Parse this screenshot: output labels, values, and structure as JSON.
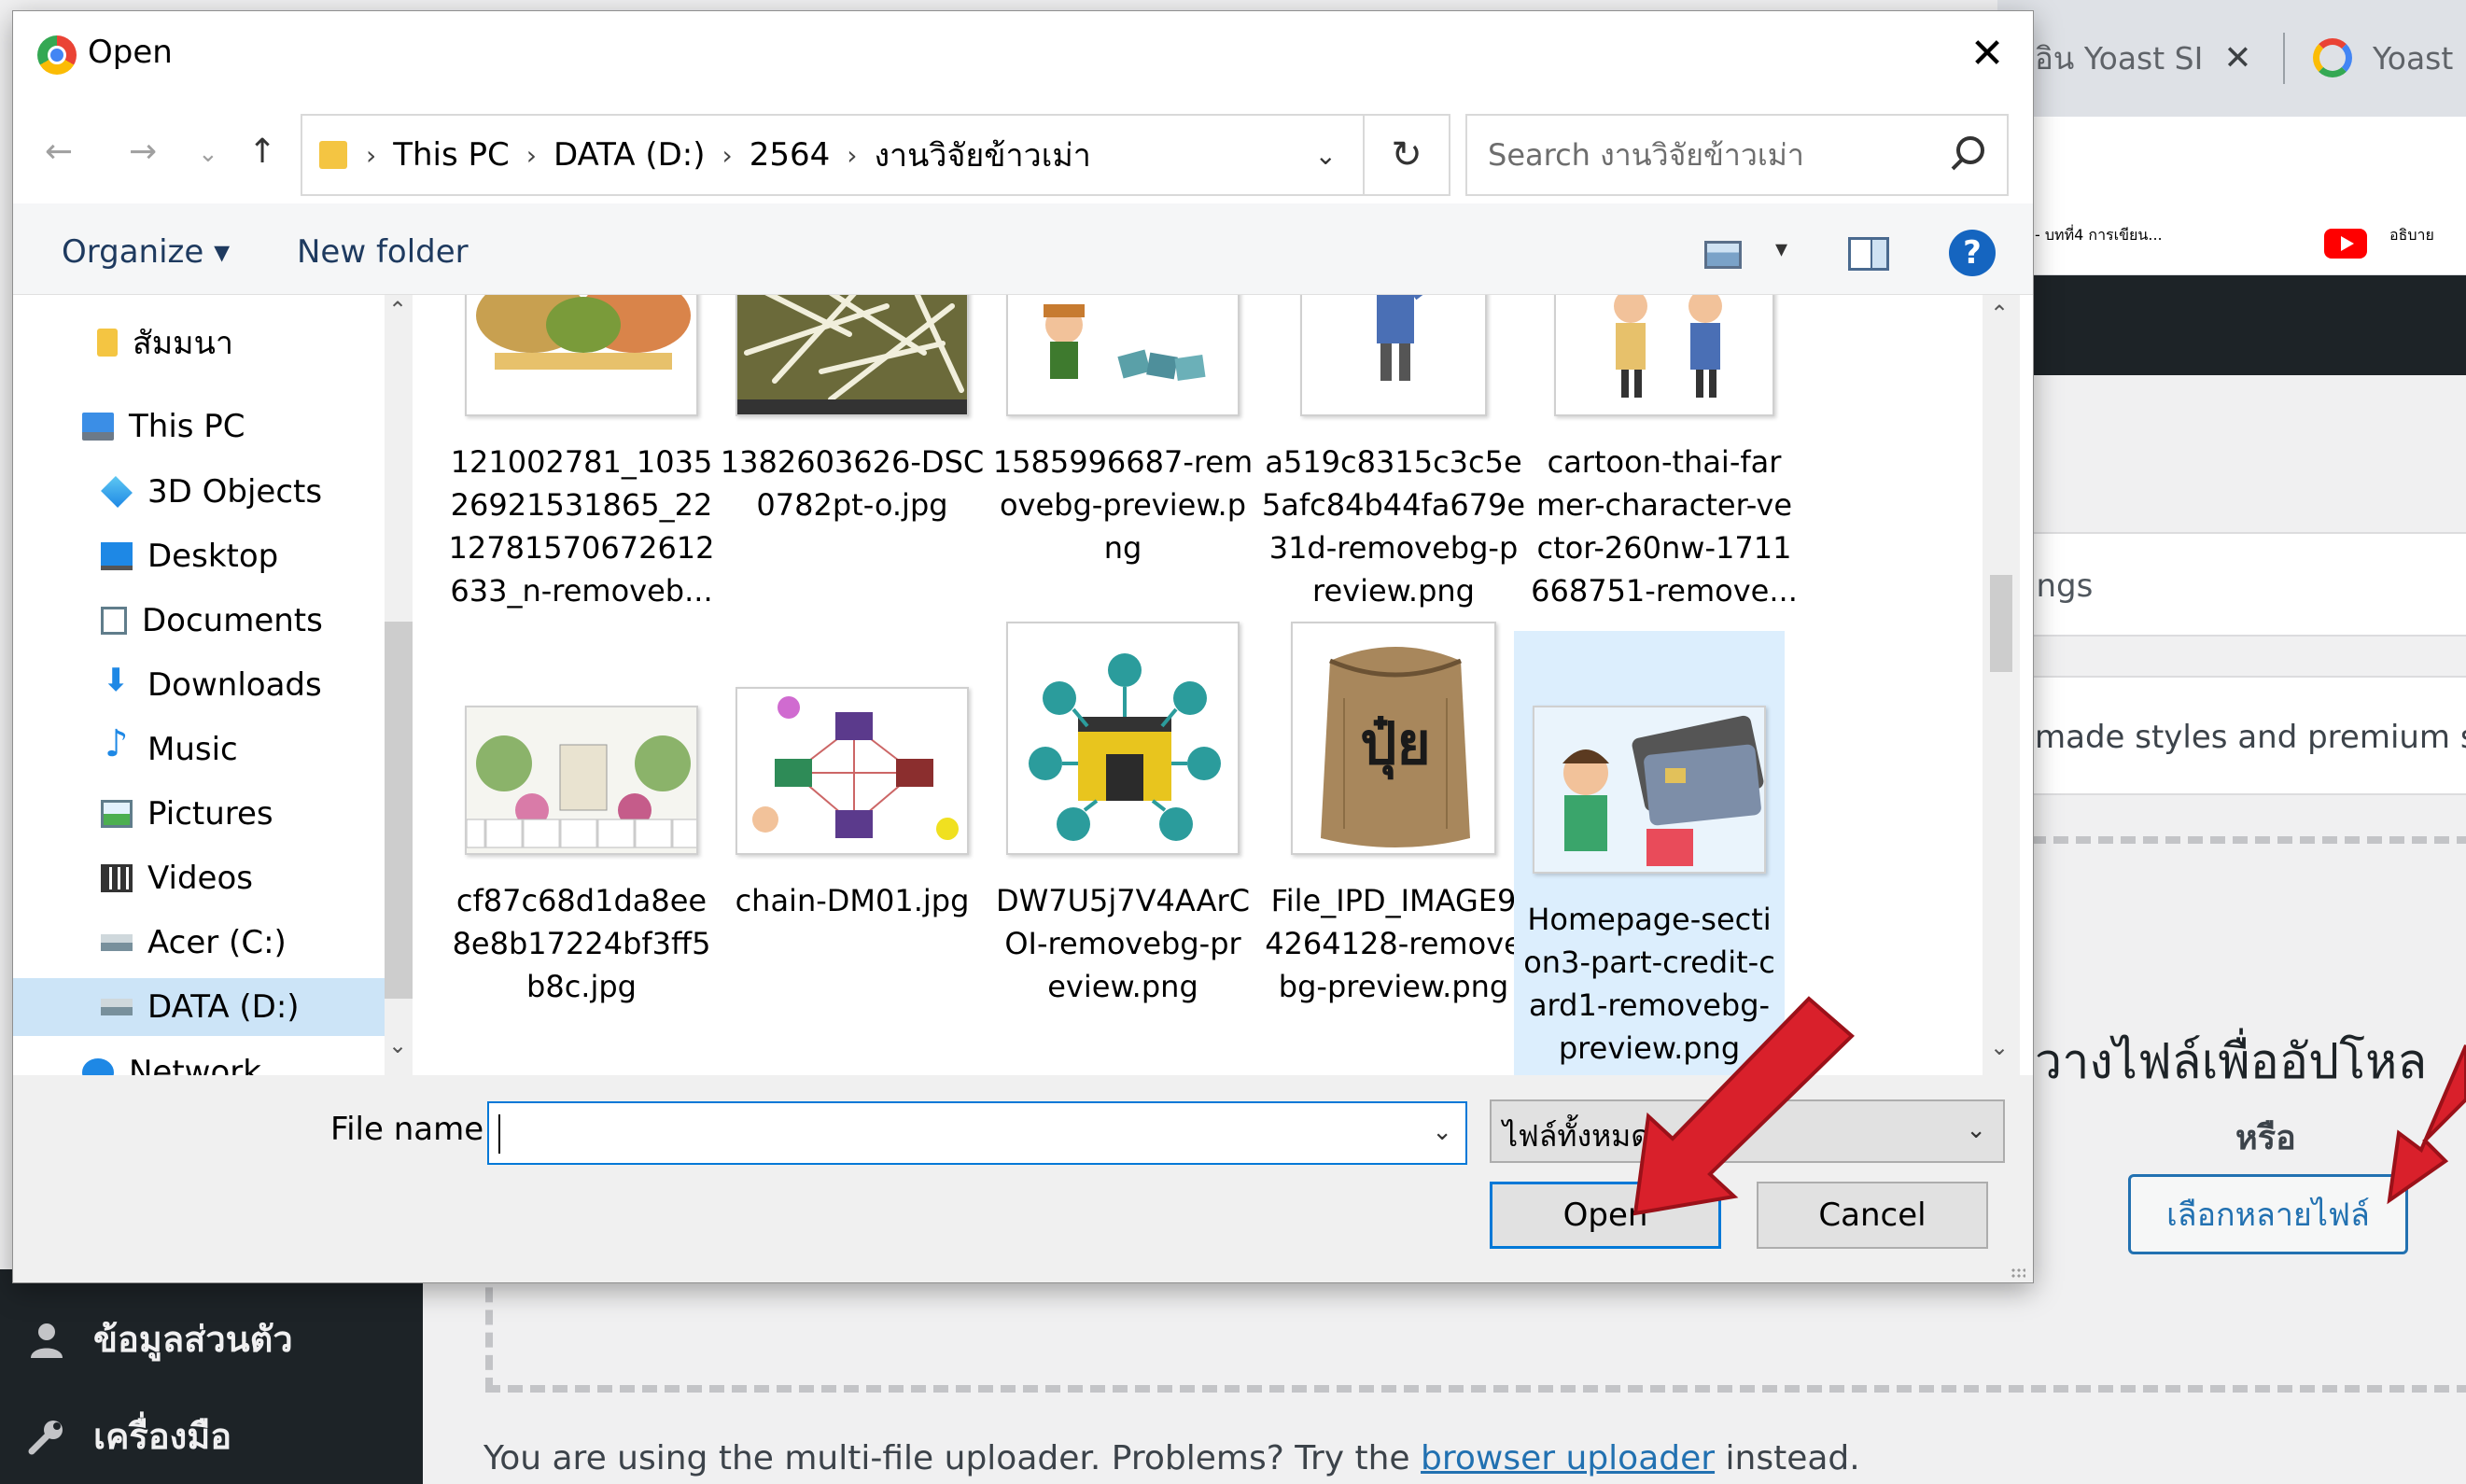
{
  "browser": {
    "tabs": [
      {
        "label": "กอิน Yoast SI",
        "close": "✕"
      },
      {
        "label": "Yoast"
      }
    ],
    "bookmarks": [
      "- บทที่4 การเขียน...",
      "อธิบาย"
    ]
  },
  "wordpress": {
    "settings_text": "ings",
    "premium_text": "made styles and premium su",
    "drop_text": "วางไฟล์เพื่ออัปโหล",
    "or_text": "หรือ",
    "select_files_label": "เลือกหลายไฟล์",
    "sidebar": {
      "items": [
        {
          "label": "ข้อมูลส่วนตัว",
          "icon": "user-icon"
        },
        {
          "label": "เครื่องมือ",
          "icon": "wrench-icon"
        }
      ]
    },
    "footer": {
      "before": "You are using the multi-file uploader. Problems? Try the ",
      "link": "browser uploader",
      "after": " instead."
    }
  },
  "dialog": {
    "title": "Open",
    "close": "✕",
    "breadcrumb": [
      "This PC",
      "DATA (D:)",
      "2564",
      "งานวิจัยข้าวเม่า"
    ],
    "search_placeholder": "Search งานวิจัยข้าวเม่า",
    "organize_label": "Organize ▾",
    "new_folder_label": "New folder",
    "help": "?",
    "nav_items": [
      {
        "label": "สัมมนา",
        "icon": "folder-icon"
      },
      {
        "label": "This PC",
        "icon": "pc-icon"
      },
      {
        "label": "3D Objects",
        "icon": "3d-objects-icon"
      },
      {
        "label": "Desktop",
        "icon": "desktop-icon"
      },
      {
        "label": "Documents",
        "icon": "documents-icon"
      },
      {
        "label": "Downloads",
        "icon": "downloads-icon"
      },
      {
        "label": "Music",
        "icon": "music-icon"
      },
      {
        "label": "Pictures",
        "icon": "pictures-icon"
      },
      {
        "label": "Videos",
        "icon": "videos-icon"
      },
      {
        "label": "Acer (C:)",
        "icon": "drive-icon"
      },
      {
        "label": "DATA (D:)",
        "icon": "drive-icon",
        "selected": true
      },
      {
        "label": "Network",
        "icon": "network-icon"
      }
    ],
    "files_row1": [
      {
        "name": "121002781_1035\n26921531865_22\n12781570672612\n633_n-removeb..."
      },
      {
        "name": "1382603626-DSC\n0782pt-o.jpg"
      },
      {
        "name": "1585996687-rem\novebg-preview.p\nng"
      },
      {
        "name": "a519c8315c3c5e\n5afc84b44fa679e\n31d-removebg-p\nreview.png"
      },
      {
        "name": "cartoon-thai-far\nmer-character-ve\nctor-260nw-1711\n668751-remove..."
      }
    ],
    "files_row2": [
      {
        "name": "cf87c68d1da8ee\n8e8b17224bf3ff5\nb8c.jpg"
      },
      {
        "name": "chain-DM01.jpg"
      },
      {
        "name": "DW7U5j7V4AArC\nOI-removebg-pr\neview.png"
      },
      {
        "name": "File_IPD_IMAGE9\n4264128-remove\nbg-preview.png"
      },
      {
        "name": "Homepage-secti\non3-part-credit-c\nard1-removebg-\npreview.png",
        "selected": true
      }
    ],
    "thumb_text": {
      "fertilizer": "ปุ๋ย"
    },
    "file_name_label": "File name:",
    "file_name_value": "",
    "file_type": "ไฟล์ทั้งหมด",
    "open_label": "Open",
    "cancel_label": "Cancel"
  },
  "colors": {
    "accent": "#0078d7",
    "arrow": "#d9202b",
    "wp_blue": "#2271b1",
    "wp_dark": "#1d2327"
  }
}
